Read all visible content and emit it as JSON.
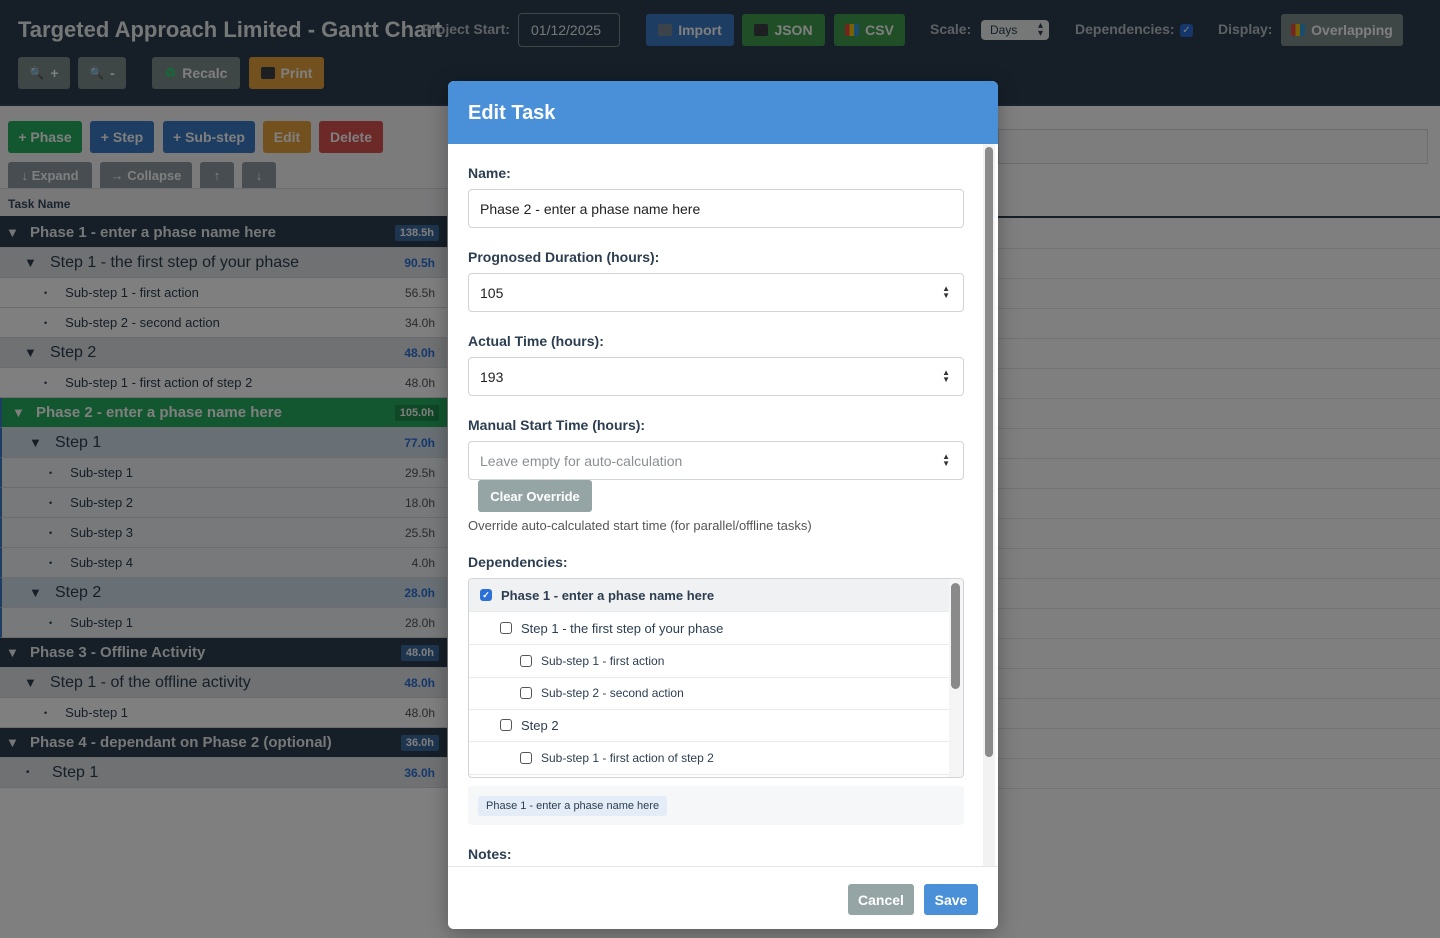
{
  "header": {
    "title": "Targeted Approach Limited - Gantt Chart",
    "project_start_label": "Project Start:",
    "project_start_value": "01/12/2025",
    "import_label": "Import",
    "json_label": "JSON",
    "csv_label": "CSV",
    "scale_label": "Scale:",
    "scale_value": "Days",
    "dependencies_label": "Dependencies:",
    "display_label": "Display:",
    "display_value": "Overlapping",
    "zoom_in_label": "+",
    "zoom_out_label": "-",
    "recalc_label": "Recalc",
    "print_label": "Print"
  },
  "toolbar": {
    "phase_label": "+ Phase",
    "step_label": "+ Step",
    "substep_label": "+ Sub-step",
    "edit_label": "Edit",
    "delete_label": "Delete",
    "expand_label": "↓ Expand",
    "collapse_label": "→ Collapse",
    "up_label": "↑",
    "down_label": "↓"
  },
  "task_table": {
    "column_header": "Task Name",
    "rows": [
      {
        "type": "phase",
        "name": "Phase 1 - enter a phase name here",
        "dur": "138.5h"
      },
      {
        "type": "step",
        "name": "Step 1 - the first step of your phase",
        "dur": "90.5h"
      },
      {
        "type": "sub",
        "name": "Sub-step 1 - first action",
        "dur": "56.5h"
      },
      {
        "type": "sub",
        "name": "Sub-step 2 - second action",
        "dur": "34.0h"
      },
      {
        "type": "step",
        "name": "Step 2",
        "dur": "48.0h"
      },
      {
        "type": "sub",
        "name": "Sub-step 1 - first action of step 2",
        "dur": "48.0h"
      },
      {
        "type": "phase-sel",
        "name": "Phase 2 - enter a phase name here",
        "dur": "105.0h"
      },
      {
        "type": "step",
        "name": "Step 1",
        "dur": "77.0h"
      },
      {
        "type": "sub",
        "name": "Sub-step 1",
        "dur": "29.5h"
      },
      {
        "type": "sub",
        "name": "Sub-step 2",
        "dur": "18.0h"
      },
      {
        "type": "sub",
        "name": "Sub-step 3",
        "dur": "25.5h"
      },
      {
        "type": "sub",
        "name": "Sub-step 4",
        "dur": "4.0h"
      },
      {
        "type": "step",
        "name": "Step 2",
        "dur": "28.0h"
      },
      {
        "type": "sub",
        "name": "Sub-step 1",
        "dur": "28.0h"
      },
      {
        "type": "phase",
        "name": "Phase 3 - Offline Activity",
        "dur": "48.0h"
      },
      {
        "type": "step",
        "name": "Step 1 - of the offline activity",
        "dur": "48.0h"
      },
      {
        "type": "sub",
        "name": "Sub-step 1",
        "dur": "48.0h"
      },
      {
        "type": "phase",
        "name": "Phase 4 - dependant on Phase 2 (optional)",
        "dur": "36.0h"
      },
      {
        "type": "step-leaf",
        "name": "Step 1",
        "dur": "36.0h"
      }
    ]
  },
  "modal": {
    "title": "Edit Task",
    "name_label": "Name:",
    "name_value": "Phase 2 - enter a phase name here",
    "duration_label": "Prognosed Duration (hours):",
    "duration_value": "105",
    "actual_label": "Actual Time (hours):",
    "actual_value": "193",
    "manual_start_label": "Manual Start Time (hours):",
    "manual_start_placeholder": "Leave empty for auto-calculation",
    "clear_override_label": "Clear Override",
    "override_hint": "Override auto-calculated start time (for parallel/offline tasks)",
    "dependencies_label": "Dependencies:",
    "dependencies": [
      {
        "name": "Phase 1 - enter a phase name here",
        "checked": true,
        "level": 0
      },
      {
        "name": "Step 1 - the first step of your phase",
        "checked": false,
        "level": 1
      },
      {
        "name": "Sub-step 1 - first action",
        "checked": false,
        "level": 2
      },
      {
        "name": "Sub-step 2 - second action",
        "checked": false,
        "level": 2
      },
      {
        "name": "Step 2",
        "checked": false,
        "level": 1
      },
      {
        "name": "Sub-step 1 - first action of step 2",
        "checked": false,
        "level": 2
      }
    ],
    "selected_dependency": "Phase 1 - enter a phase name here",
    "notes_label": "Notes:",
    "cancel_label": "Cancel",
    "save_label": "Save"
  },
  "colors": {
    "header_bg": "#2c3e50",
    "accent_blue": "#4a90d9",
    "green": "#27ae60",
    "orange": "#e6a23c",
    "red": "#d9534f",
    "gray": "#95a5a6"
  }
}
